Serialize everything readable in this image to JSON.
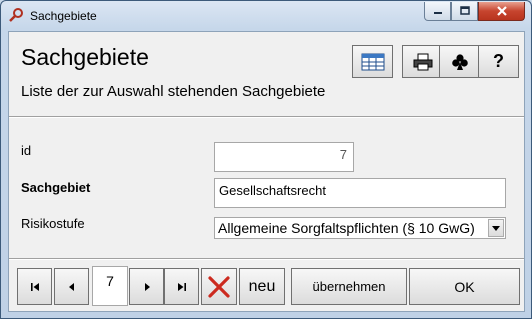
{
  "window": {
    "title": "Sachgebiete",
    "icon": "key-search-icon",
    "controls": [
      "minimize-icon",
      "maximize-icon",
      "close-icon"
    ]
  },
  "header": {
    "title": "Sachgebiete",
    "subtitle": "Liste der zur Auswahl stehenden Sachgebiete",
    "tools": [
      "datasheet-view-icon",
      "print-icon",
      "club-icon",
      "help-icon"
    ],
    "help_label": "?"
  },
  "form": {
    "id_label": "id",
    "id_value": "7",
    "sachgebiet_label": "Sachgebiet",
    "sachgebiet_value": "Gesellschaftsrecht",
    "risikostufe_label": "Risikostufe",
    "risikostufe_value": "Allgemeine Sorgfaltspflichten (§ 10 GwG)"
  },
  "navigation": {
    "record": "7",
    "delete_icon": "delete-x-icon",
    "new_label": "neu",
    "apply_label": "übernehmen",
    "ok_label": "OK"
  },
  "colors": {
    "delete": "#cc2a1f",
    "close_button": "#c7452f",
    "frame": "#c6d7ea"
  }
}
